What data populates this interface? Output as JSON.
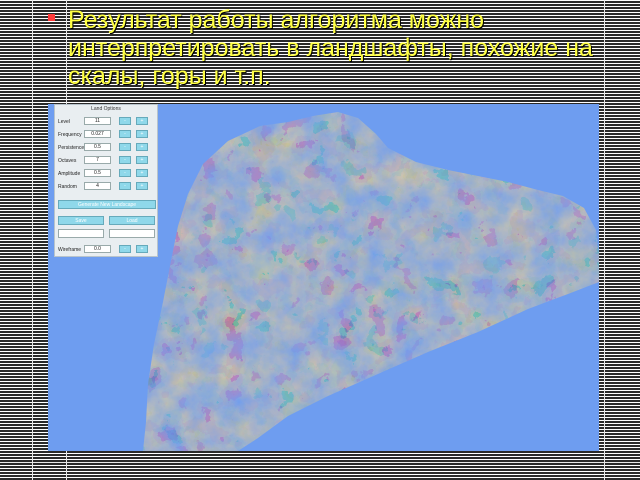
{
  "slide": {
    "bullets": [
      "Результат работы алгоритма можно интерпретировать в ландшафты, похожие на скалы, горы и т.п."
    ]
  },
  "terrain_window": {
    "colors": {
      "sky": "#6e9df0",
      "rock_light": "#a08a62",
      "rock_dark": "#20242e"
    }
  },
  "options_panel": {
    "title": "Land Options",
    "rows": [
      {
        "label": "Level",
        "value": "11",
        "minus": "-",
        "plus": "+"
      },
      {
        "label": "Frequency",
        "value": "0.027",
        "minus": "-",
        "plus": "+"
      },
      {
        "label": "Persistence",
        "value": "0.5",
        "minus": "-",
        "plus": "+"
      },
      {
        "label": "Octaves",
        "value": "7",
        "minus": "-",
        "plus": "+"
      },
      {
        "label": "Amplitude",
        "value": "0.5",
        "minus": "-",
        "plus": "+"
      },
      {
        "label": "Random",
        "value": "4",
        "minus": "-",
        "plus": "+"
      }
    ],
    "generate_button": "Generate New Landscape",
    "save_button": "Save",
    "load_button": "Load",
    "bottom_row": {
      "label": "Wireframe",
      "value": "0.0",
      "minus": "-",
      "plus": "+"
    }
  }
}
